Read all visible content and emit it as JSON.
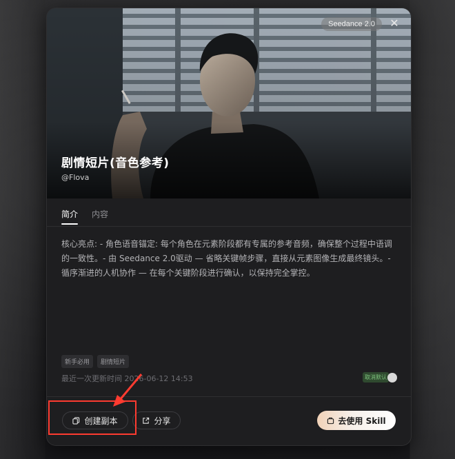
{
  "hero": {
    "version_badge": "Seedance 2.0",
    "close_glyph": "✕",
    "title": "剧情短片(音色参考)",
    "author": "@Flova"
  },
  "tabs": [
    {
      "label": "简介",
      "active": true
    },
    {
      "label": "内容",
      "active": false
    }
  ],
  "description": "核心亮点: - 角色语音锚定: 每个角色在元素阶段都有专属的参考音频，确保整个过程中语调的一致性。- 由 Seedance 2.0驱动 — 省略关键帧步骤，直接从元素图像生成最终镜头。- 循序渐进的人机协作 — 在每个关键阶段进行确认，以保持完全掌控。",
  "tags": [
    "新手必用",
    "剧情短片"
  ],
  "updated": "最近一次更新时间 2026-06-12 14:53",
  "toggle": {
    "label": "取消默认",
    "on": true
  },
  "buttons": {
    "copy": "创建副本",
    "share": "分享",
    "use": "去使用 Skill"
  },
  "icons": {
    "copy": "copy-icon",
    "share": "share-icon",
    "use": "skill-icon",
    "close": "close-icon"
  },
  "colors": {
    "accent_annotation": "#ff3b30",
    "primary_gradient_start": "#f1d2b8",
    "toggle_label": "#7fc57f"
  }
}
